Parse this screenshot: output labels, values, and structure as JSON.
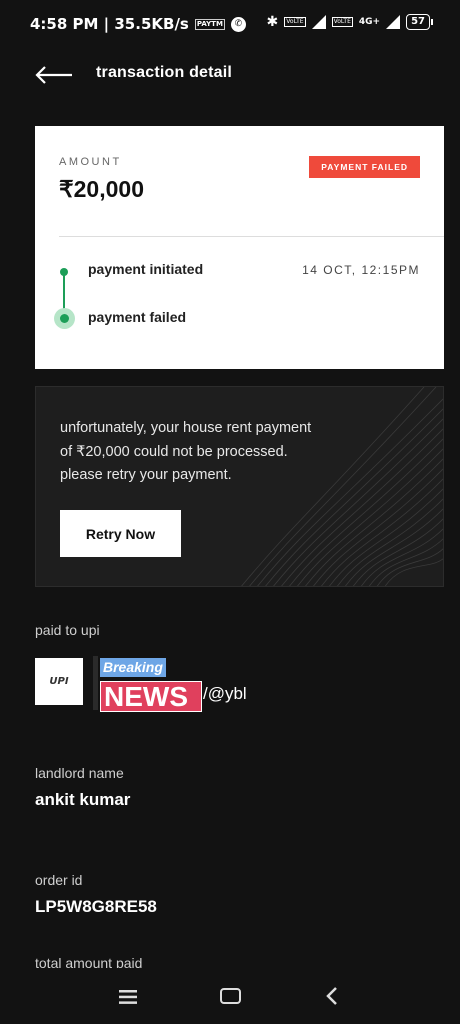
{
  "status_bar": {
    "time_info": "4:58 PM | 35.5KB/s",
    "data_icon_text": "PAYTM",
    "volte1": "VoLTE",
    "volte2": "VoLTE",
    "network": "4G+",
    "battery": "57"
  },
  "header": {
    "title": "transaction detail"
  },
  "card": {
    "amount_label": "AMOUNT",
    "amount_value": "₹20,000",
    "status_badge": "PAYMENT FAILED",
    "timeline": [
      {
        "label": "payment initiated",
        "time": "14 OCT, 12:15PM"
      },
      {
        "label": "payment failed"
      }
    ]
  },
  "failure": {
    "line1": "unfortunately, your house rent payment",
    "line2": "of ₹20,000 could not be processed.",
    "line3": "please retry your payment.",
    "retry_label": "Retry Now"
  },
  "details": {
    "paid_to_label": "paid to upi",
    "upi_logo_text": "UPI",
    "sticker_breaking": "Breaking",
    "sticker_news": "NEWS",
    "upi_suffix": "/@ybl",
    "landlord_label": "landlord name",
    "landlord_value": "ankit kumar",
    "order_label": "order id",
    "order_value": "LP5W8G8RE58",
    "total_label": "total amount paid"
  },
  "colors": {
    "background": "#121212",
    "badge_red": "#ef4a3b",
    "timeline_green": "#1d9e58"
  },
  "icons": {
    "back": "arrow-left-icon",
    "nav_menu": "menu-icon",
    "nav_home": "home-icon",
    "nav_back": "chevron-left-icon"
  }
}
